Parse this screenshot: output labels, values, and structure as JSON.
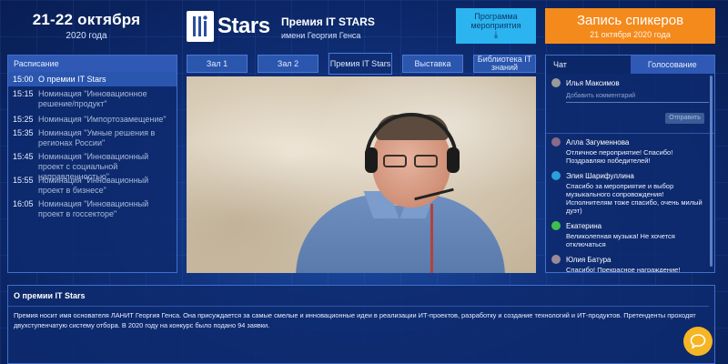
{
  "header": {
    "date": "21-22 октября",
    "year": "2020 года",
    "logo_text": "Stars",
    "prize_title": "Премия IT STARS",
    "prize_subtitle": "имени Георгия Генса",
    "program_button": "Программа мероприятия",
    "program_icon": "download-icon",
    "speakers_button": "Запись спикеров",
    "speakers_date": "21 октября 2020 года"
  },
  "schedule": {
    "title": "Расписание",
    "items": [
      {
        "time": "15:00",
        "name": "О премии IT Stars"
      },
      {
        "time": "15:15",
        "name": "Номинация \"Инновационное решение/продукт\""
      },
      {
        "time": "15:25",
        "name": "Номинация \"Импортозамещение\""
      },
      {
        "time": "15:35",
        "name": "Номинация \"Умные решения в регионах России\""
      },
      {
        "time": "15:45",
        "name": "Номинация \"Инновационный проект с социальной направленностью\""
      },
      {
        "time": "15:55",
        "name": "Номинация \"Инновационный проект в бизнесе\""
      },
      {
        "time": "16:05",
        "name": "Номинация \"Инновационный проект в госсекторе\""
      }
    ]
  },
  "tabs": [
    "Зал 1",
    "Зал 2",
    "Премия IT Stars",
    "Выставка",
    "Библиотека IT знаний"
  ],
  "chat": {
    "tab_chat": "Чат",
    "tab_vote": "Голосование",
    "current_user": "Илья Максимов",
    "comment_placeholder": "Добавить комментарий",
    "send_button": "Отправить",
    "messages": [
      {
        "name": "Алла Загуменнова",
        "text": "Отличное пероприятие! Спасибо! Поздравляю победителей!",
        "color": "#8a6a8a"
      },
      {
        "name": "Элия Шарифуллина",
        "text": "Спасибо за мероприятие и выбор музыкального сопровождения! Исполнителям тоже спасибо, очень милый дуэт)",
        "color": "#2a9fd8"
      },
      {
        "name": "Екатерина",
        "text": "Великолепная музыка!  Не хочется отключаться",
        "color": "#3fbf4a"
      },
      {
        "name": "Юлия Батура",
        "text": "Спасибо! Прекрасное награждение! Поздравляю победителей!",
        "color": "#9a8a9a"
      }
    ]
  },
  "info": {
    "title": "О премии IT Stars",
    "text": "Премия носит имя основателя ЛАНИТ Георгия Генса. Она присуждается за самые смелые и инновационные идеи в реализации ИТ-проектов, разработку и создание технологий и ИТ-продуктов. Претенденты проходят двухступенчатую систему отбора. В 2020 году на конкурс было подано 94 заявки."
  },
  "colors": {
    "accent_orange": "#f48a1c",
    "accent_blue": "#2bb4f0",
    "chat_fab": "#f6b524"
  }
}
